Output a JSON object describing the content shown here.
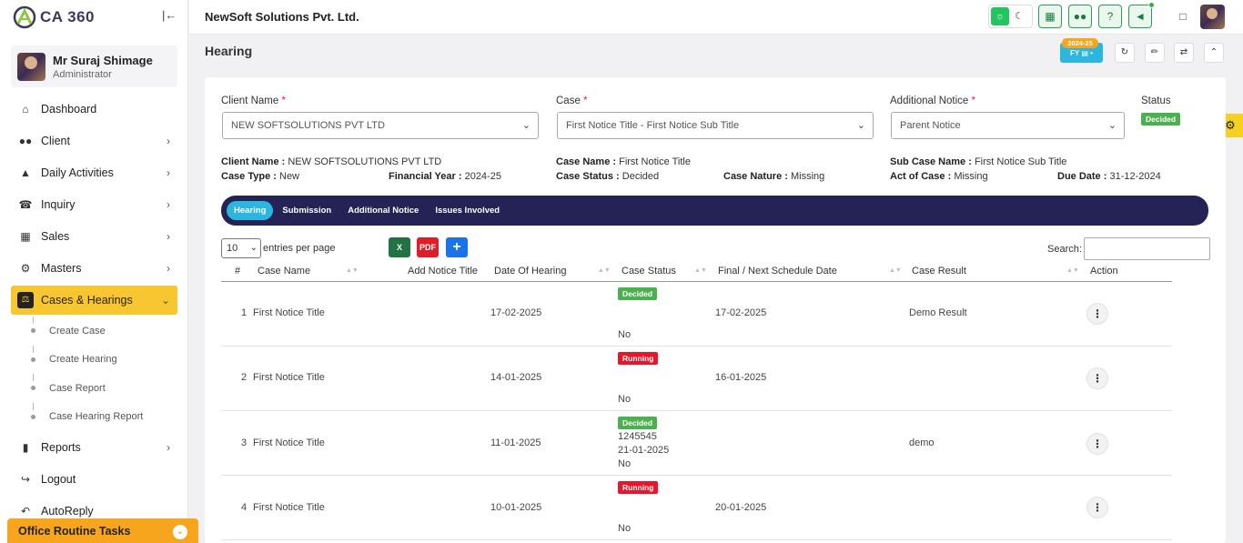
{
  "app": {
    "logo_text": "CA 360"
  },
  "user": {
    "name": "Mr Suraj Shimage",
    "role": "Administrator"
  },
  "sidebar": {
    "items": [
      {
        "label": "Dashboard",
        "icon": "home-icon",
        "has_children": false
      },
      {
        "label": "Client",
        "icon": "users-icon",
        "has_children": true
      },
      {
        "label": "Daily Activities",
        "icon": "pin-icon",
        "has_children": true
      },
      {
        "label": "Inquiry",
        "icon": "phone-icon",
        "has_children": true
      },
      {
        "label": "Sales",
        "icon": "cash-icon",
        "has_children": true
      },
      {
        "label": "Masters",
        "icon": "gears-icon",
        "has_children": true
      },
      {
        "label": "Cases & Hearings",
        "icon": "scale-icon",
        "has_children": true,
        "active": true
      },
      {
        "label": "Reports",
        "icon": "file-icon",
        "has_children": true
      },
      {
        "label": "Logout",
        "icon": "logout-icon",
        "has_children": false
      },
      {
        "label": "AutoReply",
        "icon": "reply-icon",
        "has_children": false
      }
    ],
    "sub_items": [
      "Create Case",
      "Create Hearing",
      "Case Report",
      "Case Hearing Report"
    ],
    "footer_label": "Office Routine Tasks"
  },
  "header": {
    "company": "NewSoft Solutions Pvt. Ltd."
  },
  "page": {
    "title": "Hearing",
    "fy_year": "2024-25",
    "fy_label": "FY"
  },
  "filters": {
    "client_label": "Client Name",
    "client_value": "NEW SOFTSOLUTIONS PVT LTD",
    "case_label": "Case",
    "case_value": "First Notice Title - First Notice Sub Title",
    "notice_label": "Additional Notice",
    "notice_value": "Parent Notice",
    "status_label": "Status",
    "status_value": "Decided"
  },
  "details": {
    "client_name_key": "Client Name :",
    "client_name_val": "NEW SOFTSOLUTIONS PVT LTD",
    "case_name_key": "Case Name :",
    "case_name_val": "First Notice Title",
    "sub_case_key": "Sub Case Name :",
    "sub_case_val": "First Notice Sub Title",
    "case_type_key": "Case Type :",
    "case_type_val": "New",
    "fin_year_key": "Financial Year :",
    "fin_year_val": "2024-25",
    "case_status_key": "Case Status :",
    "case_status_val": "Decided",
    "case_nature_key": "Case Nature :",
    "case_nature_val": "Missing",
    "act_key": "Act of Case :",
    "act_val": "Missing",
    "due_key": "Due Date :",
    "due_val": "31-12-2024"
  },
  "tabs": [
    "Hearing",
    "Submission",
    "Additional Notice",
    "Issues Involved"
  ],
  "table": {
    "page_size": "10",
    "entries_label": "entries per page",
    "search_label": "Search:",
    "columns": [
      "#",
      "Case Name",
      "Add Notice Title",
      "Date Of Hearing",
      "Case Status",
      "Final / Next Schedule Date",
      "Case Result",
      "Action"
    ],
    "rows": [
      {
        "num": "1",
        "case_name": "First Notice Title",
        "date": "17-02-2025",
        "status": "Decided",
        "status_color": "green",
        "extra1": "",
        "extra2": "",
        "flag": "No",
        "next_date": "17-02-2025",
        "result": "Demo Result"
      },
      {
        "num": "2",
        "case_name": "First Notice Title",
        "date": "14-01-2025",
        "status": "Running",
        "status_color": "red",
        "extra1": "",
        "extra2": "",
        "flag": "No",
        "next_date": "16-01-2025",
        "result": ""
      },
      {
        "num": "3",
        "case_name": "First Notice Title",
        "date": "11-01-2025",
        "status": "Decided",
        "status_color": "green",
        "extra1": "1245545",
        "extra2": "21-01-2025",
        "flag": "No",
        "next_date": "",
        "result": "demo"
      },
      {
        "num": "4",
        "case_name": "First Notice Title",
        "date": "10-01-2025",
        "status": "Running",
        "status_color": "red",
        "extra1": "",
        "extra2": "",
        "flag": "No",
        "next_date": "20-01-2025",
        "result": ""
      }
    ]
  },
  "colors": {
    "accent": "#f8c630",
    "tabs_bg": "#252256",
    "active_tab": "#2bb6e0",
    "decided": "#4caf50",
    "running": "#e8162b"
  }
}
